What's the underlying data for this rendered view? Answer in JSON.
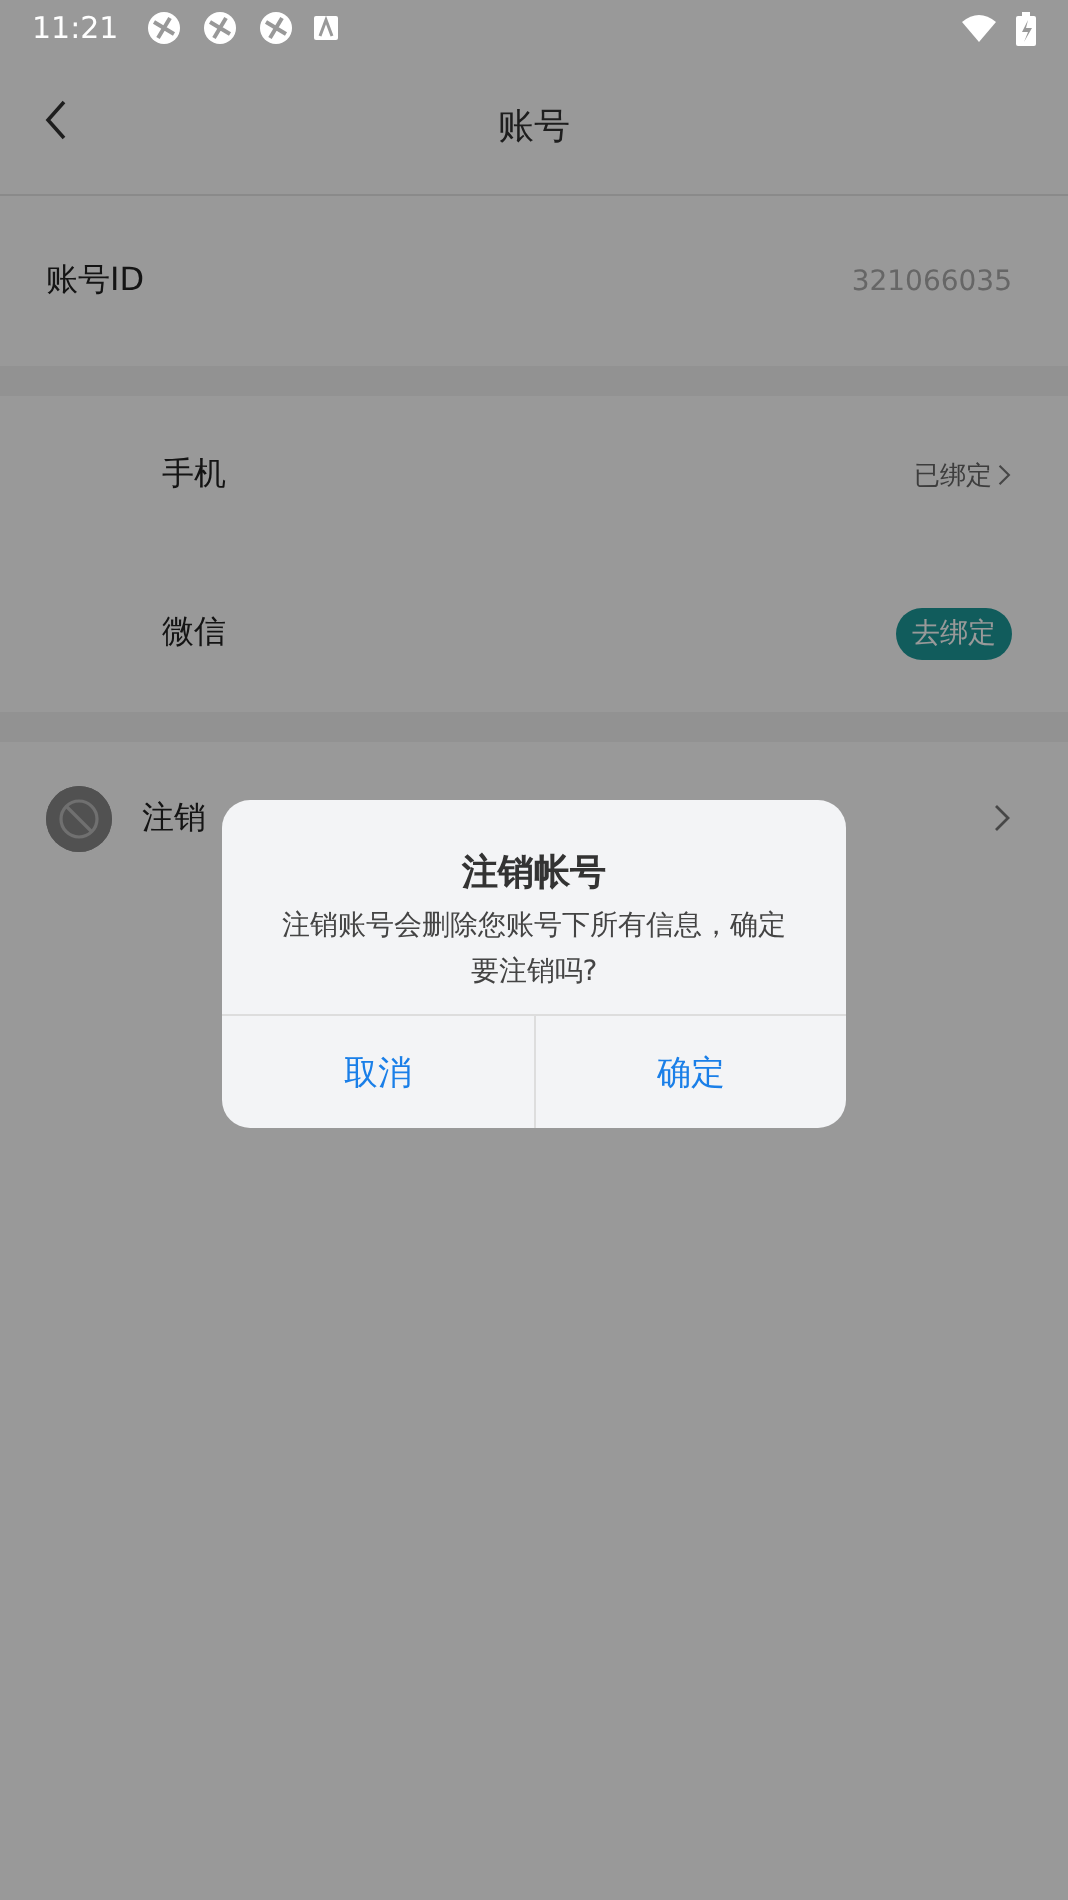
{
  "status_bar": {
    "time": "11:21"
  },
  "header": {
    "title": "账号"
  },
  "account_id": {
    "label": "账号ID",
    "value": "321066035"
  },
  "bindings": [
    {
      "label": "手机",
      "kind": "status",
      "status": "已绑定"
    },
    {
      "label": "微信",
      "kind": "action",
      "action": "去绑定"
    }
  ],
  "cancel_row": {
    "label": "注销"
  },
  "dialog": {
    "title": "注销帐号",
    "message": "注销账号会删除您账号下所有信息，确定要注销吗?",
    "buttons": [
      "取消",
      "确定"
    ]
  }
}
